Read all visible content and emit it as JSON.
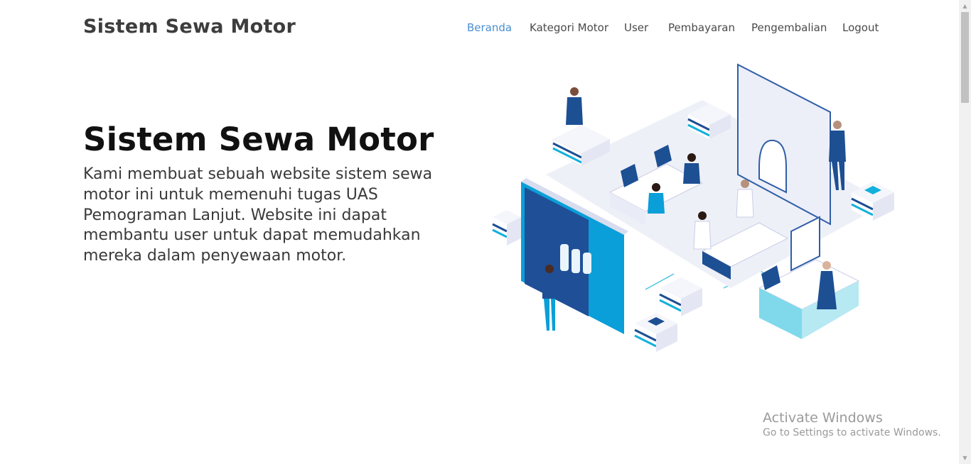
{
  "navbar": {
    "brand": "Sistem Sewa Motor",
    "links": [
      {
        "label": "Beranda",
        "active": true
      },
      {
        "label": "Kategori Motor"
      },
      {
        "label": "User"
      },
      {
        "label": "Pembayaran"
      },
      {
        "label": "Pengembalian"
      },
      {
        "label": "Logout"
      }
    ]
  },
  "hero": {
    "title": "Sistem Sewa Motor",
    "description": "Kami membuat sebuah website sistem sewa motor ini untuk memenuhi tugas UAS Pemograman Lanjut. Website ini dapat membantu user untuk dapat memudahkan mereka dalam penyewaan motor."
  },
  "watermark": {
    "title": "Activate Windows",
    "subtitle": "Go to Settings to activate Windows."
  },
  "colors": {
    "accent": "#4a8fd1",
    "illustration_blue": "#1e4f95",
    "illustration_cyan": "#13b0dc"
  }
}
